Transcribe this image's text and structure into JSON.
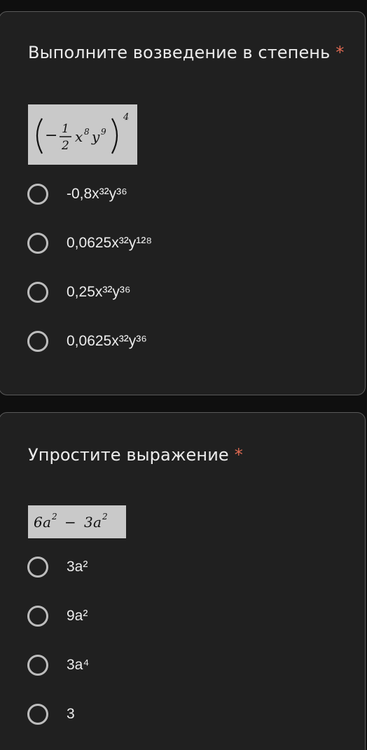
{
  "questions": [
    {
      "title": "Выполните возведение в степень",
      "required_mark": "*",
      "image": {
        "sign": "−",
        "numerator": "1",
        "denominator": "2",
        "base_x": "x",
        "exp_x": "8",
        "base_y": "y",
        "exp_y": "9",
        "outer_exp": "4"
      },
      "options": [
        "-0,8x³²y³⁶",
        "0,0625x³²y¹²⁸",
        "0,25x³²y³⁶",
        "0,0625x³²y³⁶"
      ]
    },
    {
      "title": "Упростите выражение",
      "required_mark": "*",
      "image": {
        "term1_coef": "6",
        "term1_var": "a",
        "term1_exp": "2",
        "op": "−",
        "term2_coef": "3",
        "term2_var": "a",
        "term2_exp": "2"
      },
      "options": [
        "3a²",
        "9a²",
        "3a⁴",
        "3"
      ]
    }
  ],
  "colors": {
    "page_bg": "#0f0f0f",
    "card_bg": "#202020",
    "card_border": "#5a5a5a",
    "required": "#e06a52",
    "radio_ring": "#bdbdbd",
    "image_bg": "#c9c9c9"
  }
}
